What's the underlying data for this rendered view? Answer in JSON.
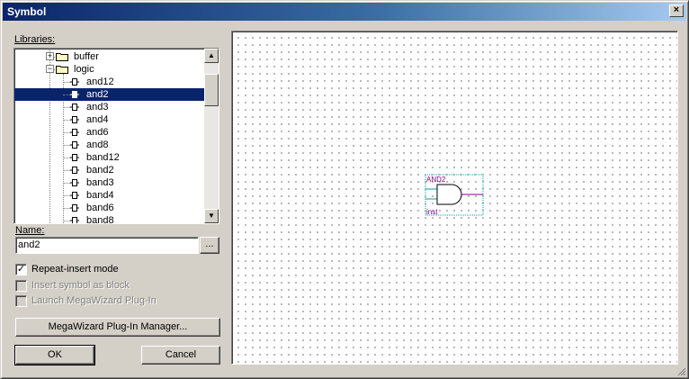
{
  "window": {
    "title": "Symbol",
    "close_glyph": "×"
  },
  "libraries_label": "Libraries:",
  "tree": {
    "rows": [
      {
        "label": "buffer",
        "kind": "folder",
        "expanded": false
      },
      {
        "label": "logic",
        "kind": "folder",
        "expanded": true
      },
      {
        "label": "and12",
        "kind": "symbol"
      },
      {
        "label": "and2",
        "kind": "symbol",
        "selected": true
      },
      {
        "label": "and3",
        "kind": "symbol"
      },
      {
        "label": "and4",
        "kind": "symbol"
      },
      {
        "label": "and6",
        "kind": "symbol"
      },
      {
        "label": "and8",
        "kind": "symbol"
      },
      {
        "label": "band12",
        "kind": "symbol"
      },
      {
        "label": "band2",
        "kind": "symbol"
      },
      {
        "label": "band3",
        "kind": "symbol"
      },
      {
        "label": "band4",
        "kind": "symbol"
      },
      {
        "label": "band6",
        "kind": "symbol"
      },
      {
        "label": "band8",
        "kind": "symbol"
      }
    ]
  },
  "name_label": "Name:",
  "name_value": "and2",
  "browse_label": "...",
  "options": {
    "repeat_insert": {
      "label": "Repeat-insert mode",
      "checked": true,
      "enabled": true
    },
    "insert_block": {
      "label": "Insert symbol as block",
      "checked": false,
      "enabled": false
    },
    "launch_wizard": {
      "label": "Launch MegaWizard Plug-In",
      "checked": false,
      "enabled": false
    }
  },
  "megawizard_button": "MegaWizard Plug-In Manager...",
  "ok_button": "OK",
  "cancel_button": "Cancel",
  "preview": {
    "symbol_name": "AND2",
    "instance_name": "inst"
  },
  "colors": {
    "title_gradient_start": "#0a246a",
    "selection": "#0a246a",
    "symbol_text": "#800080",
    "symbol_border": "#00a0a0"
  },
  "check_glyph": "✓"
}
